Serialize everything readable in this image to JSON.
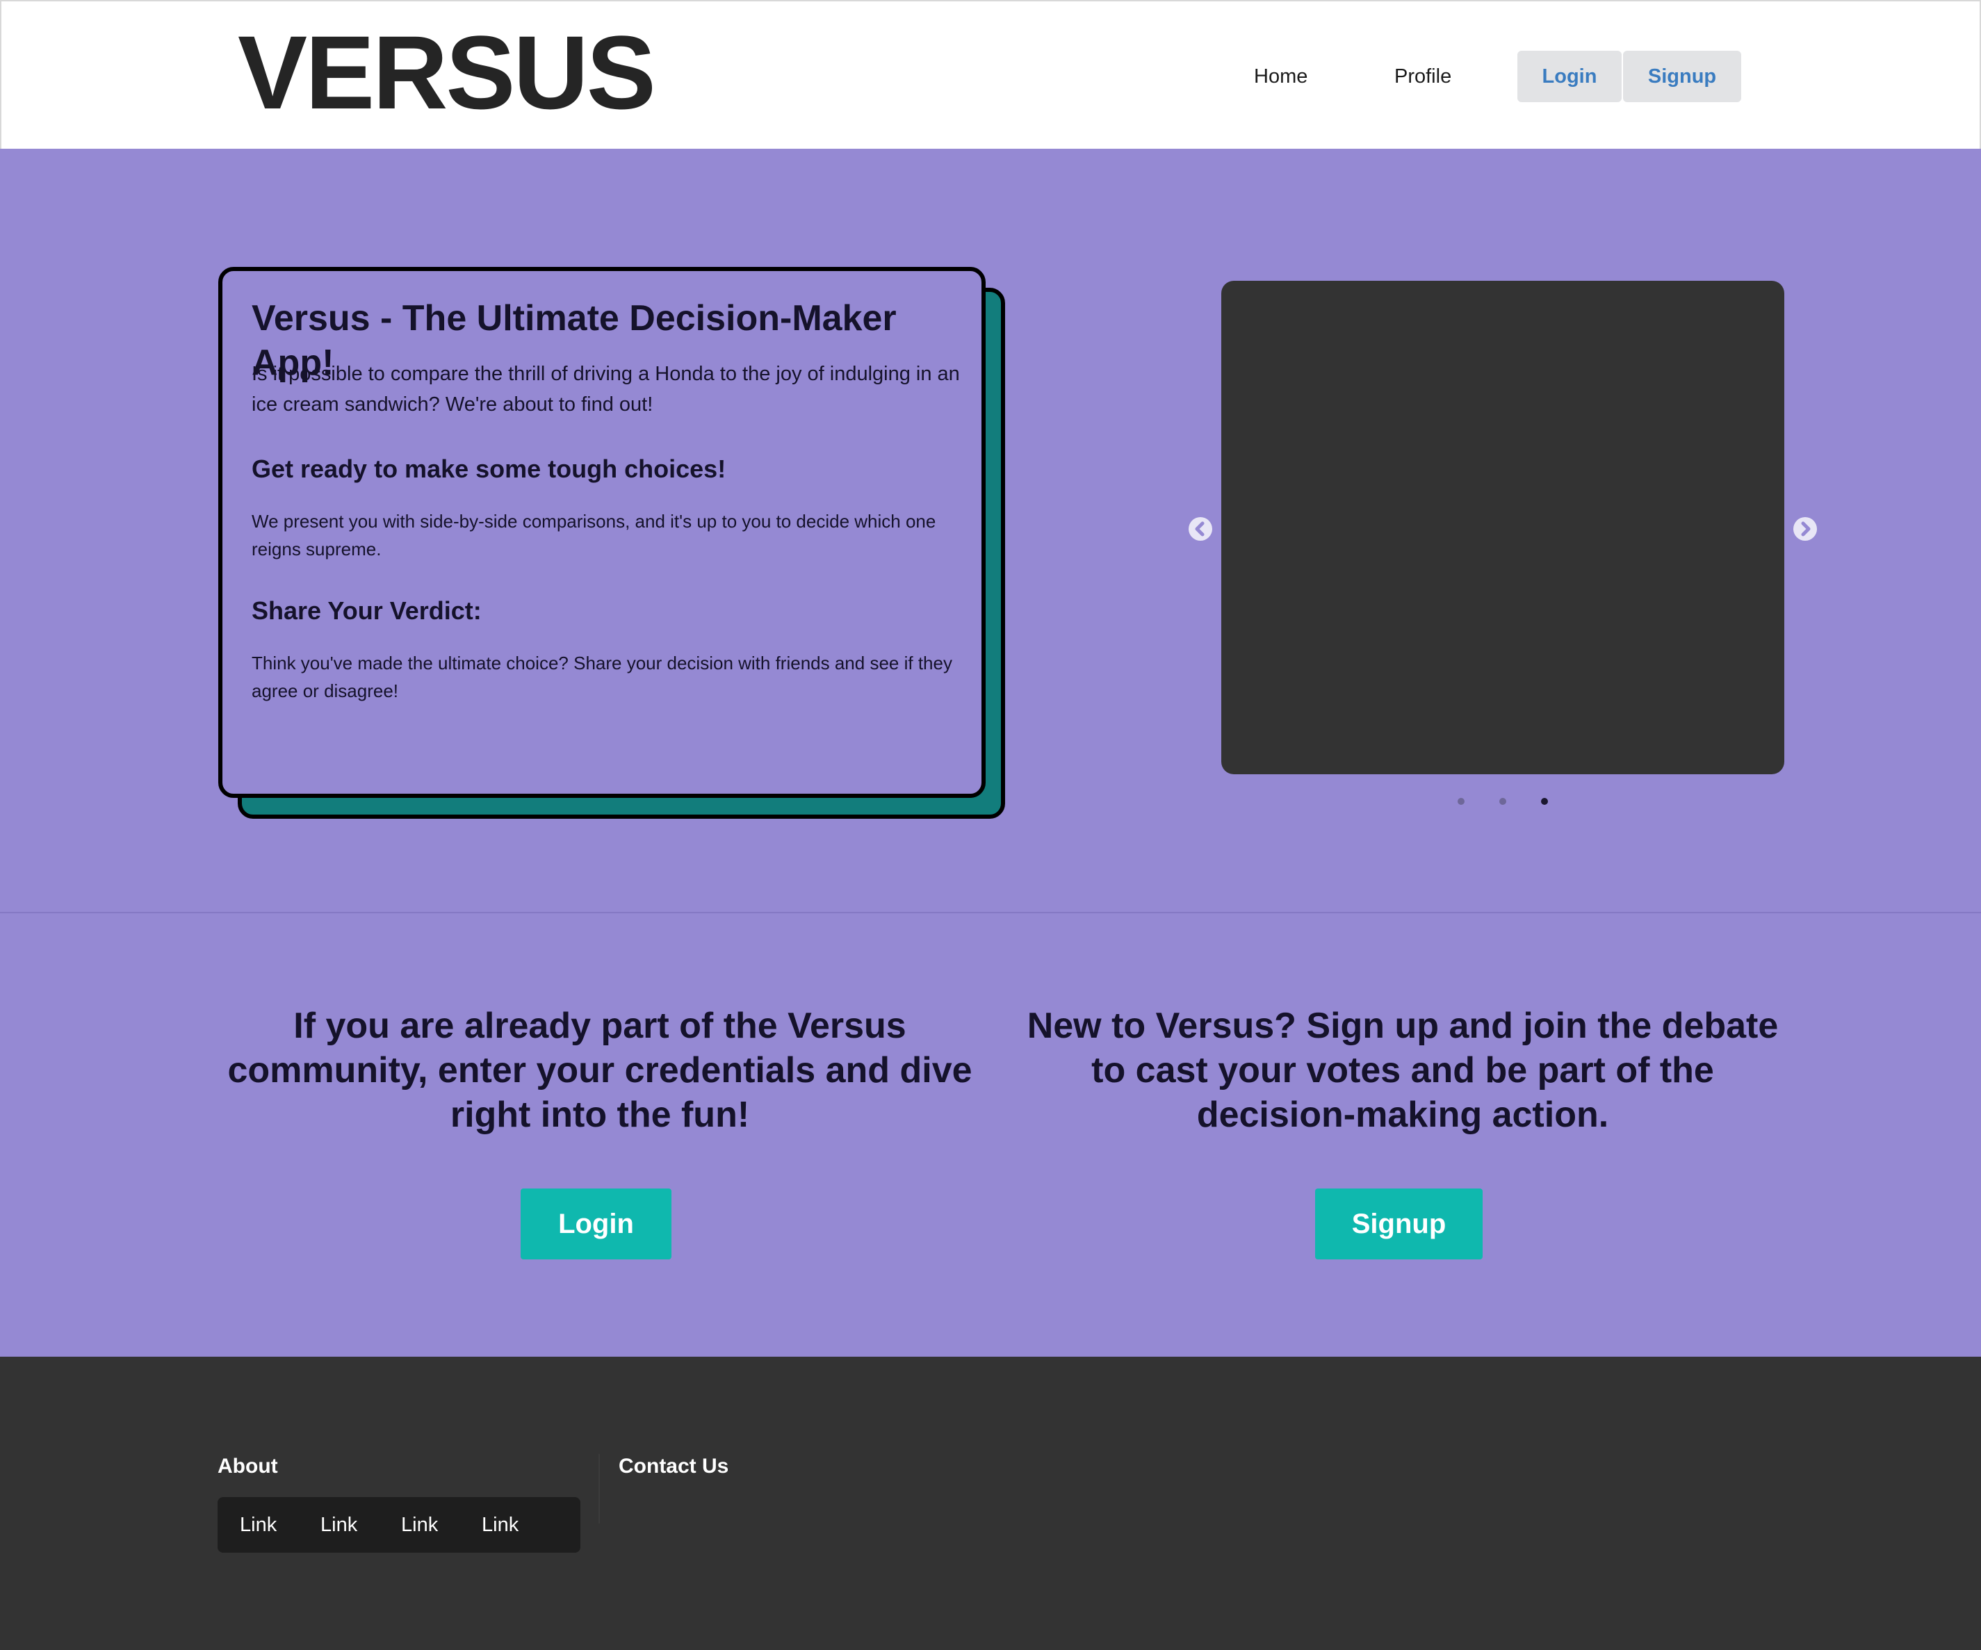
{
  "header": {
    "logo": "VERSUS",
    "nav": {
      "home": "Home",
      "profile": "Profile",
      "login": "Login",
      "signup": "Signup"
    }
  },
  "hero": {
    "card": {
      "title": "Versus - The Ultimate Decision-Maker App!",
      "intro": "Is it possible to compare the thrill of driving a Honda to the joy of indulging in an ice cream sandwich? We're about to find out!",
      "heading2": "Get ready to make some tough choices!",
      "text2": "We present you with side-by-side comparisons, and it's up to you to decide which one reigns supreme.",
      "heading3": "Share Your Verdict:",
      "text3": "Think you've made the ultimate choice? Share your decision with friends and see if they agree or disagree!"
    },
    "carousel": {
      "prev_icon": "chevron-left-circle-icon",
      "next_icon": "chevron-right-circle-icon",
      "active_slide": 3,
      "total_slides": 3
    }
  },
  "cta": {
    "login_text": "If you are already part of the Versus community, enter your credentials and dive right into the fun!",
    "login_button": "Login",
    "signup_text": "New to Versus? Sign up and join the debate to cast your votes and be part of the decision-making action.",
    "signup_button": "Signup"
  },
  "footer": {
    "about_heading": "About",
    "contact_heading": "Contact Us",
    "links": [
      "Link",
      "Link",
      "Link",
      "Link"
    ]
  },
  "colors": {
    "brand_purple": "#9589d3",
    "teal_button": "#0fb8ae",
    "card_shadow_teal": "#127d7c",
    "footer_dark": "#333333",
    "nav_button_text": "#3a7cc0"
  }
}
